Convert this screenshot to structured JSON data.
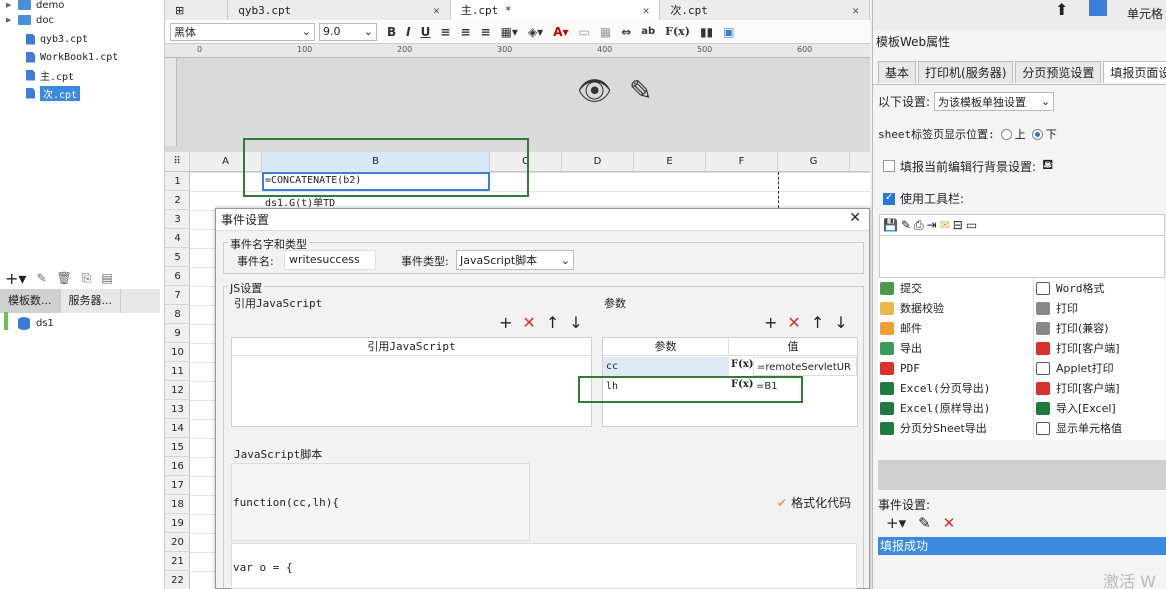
{
  "tree": {
    "items": [
      {
        "label": "demo",
        "type": "folder"
      },
      {
        "label": "doc",
        "type": "folder"
      },
      {
        "label": "qyb3.cpt",
        "type": "file"
      },
      {
        "label": "WorkBook1.cpt",
        "type": "file"
      },
      {
        "label": "主.cpt",
        "type": "file"
      },
      {
        "label": "次.cpt",
        "type": "file",
        "selected": true
      }
    ]
  },
  "left_tabs": [
    "模板数...",
    "服务器..."
  ],
  "datasets": [
    "ds1"
  ],
  "file_tabs": [
    {
      "label": "qyb3.cpt",
      "active": false
    },
    {
      "label": "主.cpt *",
      "active": true
    },
    {
      "label": "次.cpt",
      "active": false
    }
  ],
  "format_bar": {
    "font": "黑体",
    "size": "9.0",
    "bold": "B",
    "italic": "I",
    "underline": "U",
    "fx": "F(x)"
  },
  "ruler_marks": [
    "0",
    "100",
    "200",
    "300",
    "400",
    "500",
    "600"
  ],
  "columns": [
    "A",
    "B",
    "C",
    "D",
    "E",
    "F",
    "G"
  ],
  "rows": [
    "1",
    "2",
    "3",
    "4",
    "5",
    "6",
    "7",
    "8",
    "9",
    "10",
    "11",
    "12",
    "13",
    "14",
    "15",
    "16",
    "17",
    "18",
    "19",
    "20",
    "21",
    "22"
  ],
  "cells": {
    "b1": "=CONCATENATE(b2)",
    "b2": "ds1.G(t)单TD"
  },
  "dialog": {
    "title": "事件设置",
    "name_group": "事件名字和类型",
    "event_name_label": "事件名:",
    "event_name_value": "writesuccess",
    "event_type_label": "事件类型:",
    "event_type_value": "JavaScript脚本",
    "js_group": "JS设置",
    "ref_js_label": "引用JavaScript",
    "ref_js_header": "引用JavaScript",
    "params_label": "参数",
    "params_headers": [
      "参数",
      "值"
    ],
    "params": [
      {
        "name": "cc",
        "value": "=remoteServletUR"
      },
      {
        "name": "lh",
        "value": "=B1"
      }
    ],
    "script_label": "JavaScript脚本",
    "function_sig": "function(cc,lh){",
    "format_code": "格式化代码",
    "code_line": "var o = {"
  },
  "right_panel": {
    "top_label": "单元格",
    "title": "模板Web属性",
    "tabs": [
      "基本",
      "打印机(服务器)",
      "分页预览设置",
      "填报页面设"
    ],
    "setting_label": "以下设置:",
    "setting_value": "为该模板单独设置",
    "sheet_pos_label": "sheet标签页显示位置:",
    "pos_up": "上",
    "pos_down": "下",
    "fill_bg_label": "填报当前编辑行背景设置:",
    "use_toolbar": "使用工具栏:",
    "tools_left": [
      "提交",
      "数据校验",
      "邮件",
      "导出",
      "PDF",
      "Excel(分页导出)",
      "Excel(原样导出)",
      "分页分Sheet导出"
    ],
    "tools_right": [
      "Word格式",
      "打印",
      "打印(兼容)",
      "打印[客户端]",
      "Applet打印",
      "打印[客户端]",
      "导入[Excel]",
      "显示单元格值"
    ],
    "event_settings": "事件设置:",
    "event_item": "填报成功",
    "watermark": "激活 W"
  },
  "colors": {
    "accent": "#3c8ae0",
    "highlight_box": "#2e7d32",
    "delete": "#d9302c"
  }
}
